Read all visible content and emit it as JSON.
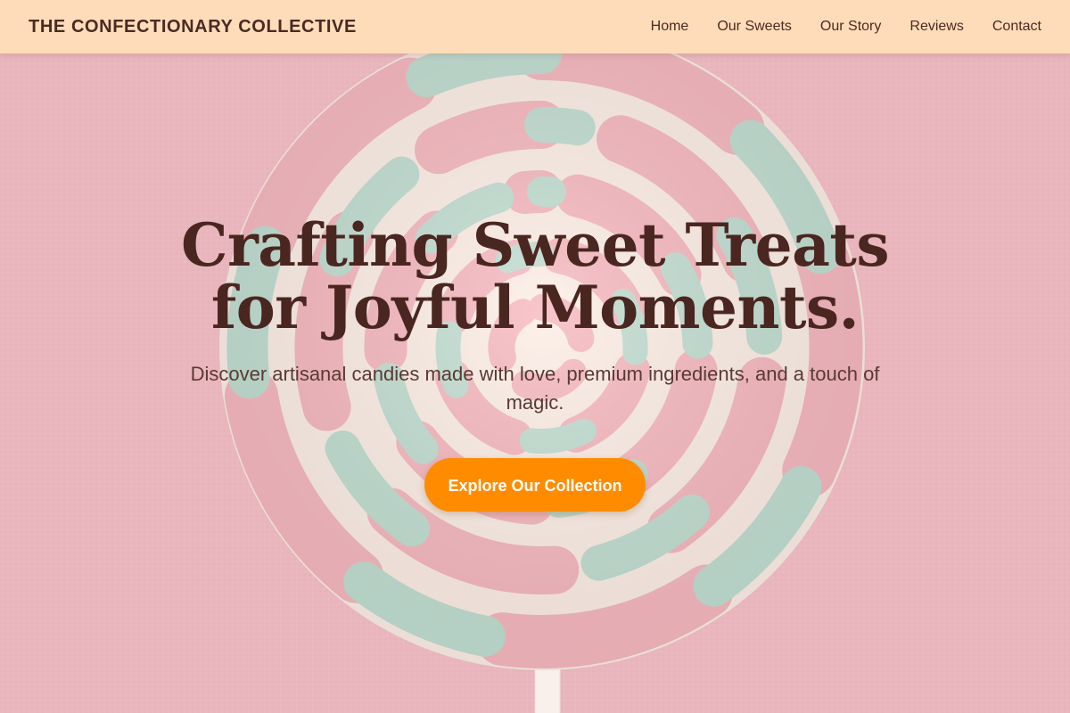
{
  "nav": {
    "brand": "THE CONFECTIONARY COLLECTIVE",
    "links": [
      {
        "label": "Home"
      },
      {
        "label": "Our Sweets"
      },
      {
        "label": "Our Story"
      },
      {
        "label": "Reviews"
      },
      {
        "label": "Contact"
      }
    ]
  },
  "hero": {
    "title": "Crafting Sweet Treats for Joyful Moments.",
    "subtitle": "Discover artisanal candies made with love, premium ingredients, and a touch of magic.",
    "cta_label": "Explore Our Collection",
    "background_image": "swirl-lollipop-photo"
  },
  "colors": {
    "navbar_bg": "#ffdcb9",
    "brand_text": "#4a2a22",
    "title_text": "#4a2620",
    "cta_bg": "#ff8c00",
    "cta_text": "#ffffff",
    "backdrop_pink": "#d9909f",
    "candy_pink": "#ef8f9f",
    "candy_mint": "#8fd3c0",
    "candy_cream": "#fbf1e6"
  }
}
